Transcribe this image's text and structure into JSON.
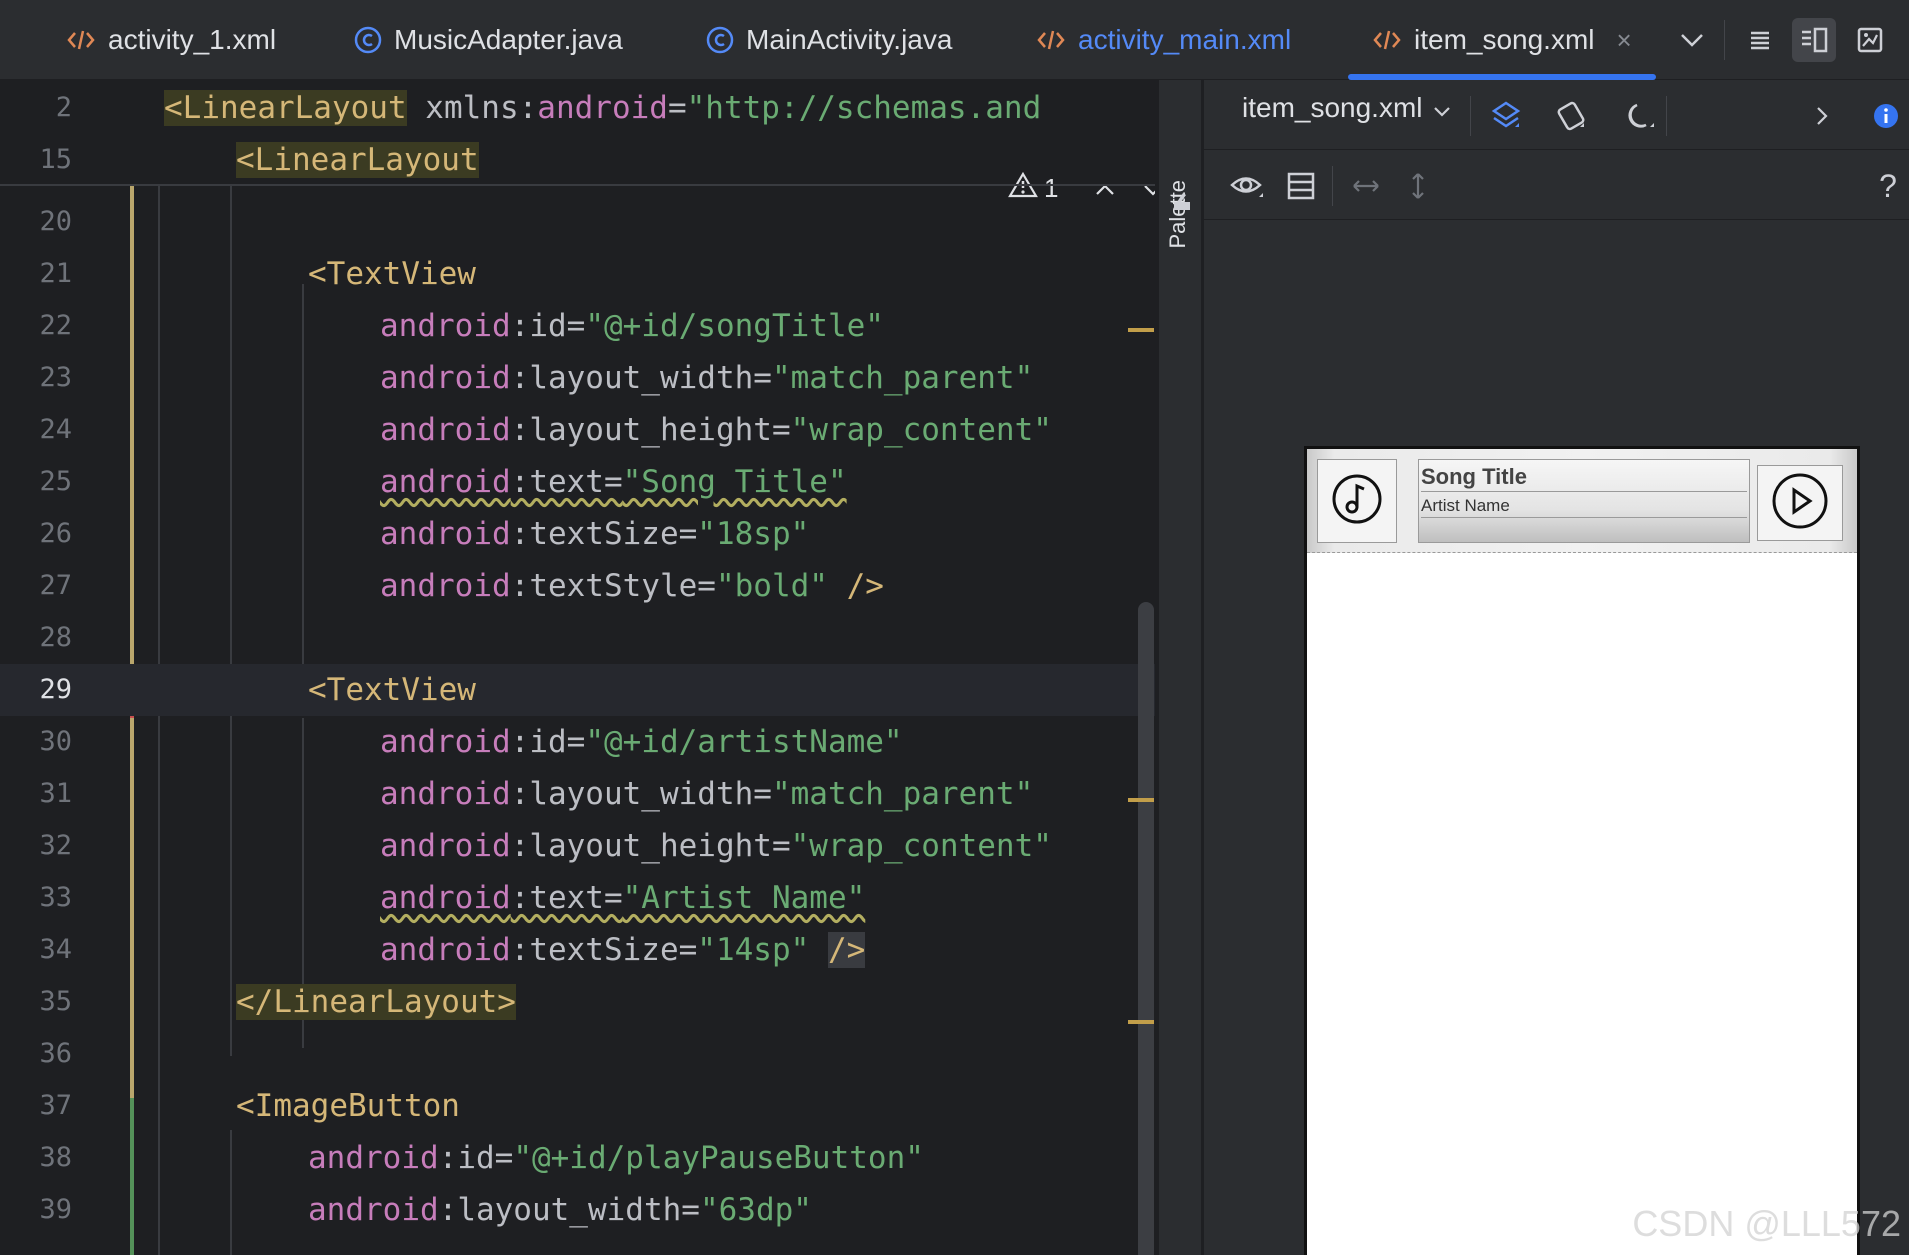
{
  "tabs": [
    {
      "label": "activity_1.xml",
      "icon": "xml-file-icon",
      "state": "normal"
    },
    {
      "label": "MusicAdapter.java",
      "icon": "java-class-icon",
      "state": "normal"
    },
    {
      "label": "MainActivity.java",
      "icon": "java-class-icon",
      "state": "normal"
    },
    {
      "label": "activity_main.xml",
      "icon": "xml-file-icon",
      "state": "modified"
    },
    {
      "label": "item_song.xml",
      "icon": "xml-file-icon",
      "state": "active"
    }
  ],
  "tab_close": "×",
  "inspection": {
    "count": "1"
  },
  "sticky": {
    "l2": {
      "num": "2",
      "tag": "<LinearLayout",
      "rest": " xmlns:",
      "ns": "android",
      "eq": "=",
      "val": "\"http://schemas.and"
    },
    "l15": {
      "num": "15",
      "tag": "<LinearLayout"
    }
  },
  "lines": {
    "l20": "20",
    "l21": "21",
    "l22": "22",
    "l23": "23",
    "l24": "24",
    "l25": "25",
    "l26": "26",
    "l27": "27",
    "l28": "28",
    "l29": "29",
    "l30": "30",
    "l31": "31",
    "l32": "32",
    "l33": "33",
    "l34": "34",
    "l35": "35",
    "l36": "36",
    "l37": "37",
    "l38": "38",
    "l39": "39"
  },
  "code": {
    "textview": "<TextView",
    "ns": "android",
    "id": ":id=",
    "layout_width": ":layout_width=",
    "layout_height": ":layout_height=",
    "text": ":text=",
    "textSize": ":textSize=",
    "textStyle": ":textStyle=",
    "v_songTitle": "\"@+id/songTitle\"",
    "v_match": "\"match_parent\"",
    "v_wrap": "\"wrap_content\"",
    "v_songTitleText": "\"Song Title\"",
    "v_18sp": "\"18sp\"",
    "v_bold": "\"bold\"",
    "selfclose": " />",
    "v_artistName": "\"@+id/artistName\"",
    "v_artistText": "\"Artist Name\"",
    "v_14sp": "\"14sp\"",
    "selfclose2": "/>",
    "close_ll": "</LinearLayout>",
    "imagebutton": "<ImageButton",
    "v_playPause": "\"@+id/playPauseButton\"",
    "v_63dp": "\"63dp\""
  },
  "design": {
    "file": "item_song.xml",
    "palette": "Palette",
    "help": "?"
  },
  "preview": {
    "song_title": "Song Title",
    "artist_name": "Artist Name"
  },
  "watermark": "CSDN @LLL572",
  "colors": {
    "accent": "#3574f0",
    "tag": "#d5b778",
    "namespace": "#c77dbb",
    "string": "#6aab73",
    "modified_tab": "#548af7"
  }
}
